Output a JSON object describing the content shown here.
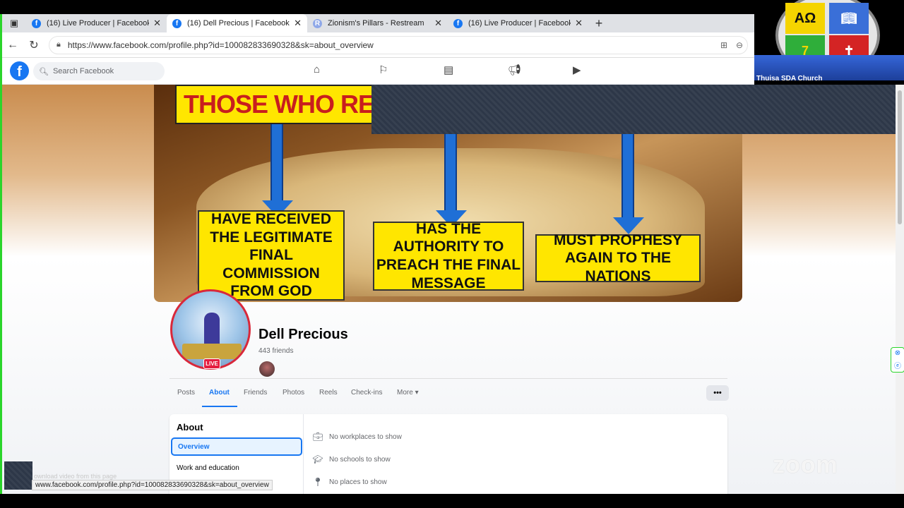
{
  "browser": {
    "tabs": [
      {
        "title": "(16) Live Producer | Facebook",
        "icon": "facebook-icon",
        "active": false
      },
      {
        "title": "(16) Dell Precious | Facebook",
        "icon": "facebook-icon",
        "active": true
      },
      {
        "title": "Zionism's Pillars - Restream",
        "icon": "restream-icon",
        "active": false
      },
      {
        "title": "(16) Live Producer | Facebook",
        "icon": "facebook-icon",
        "active": false
      }
    ],
    "url": "https://www.facebook.com/profile.php?id=100082833690328&sk=about_overview",
    "status_url": "www.facebook.com/profile.php?id=100082833690328&sk=about_overview",
    "faint_text": "ownload video from this page"
  },
  "facebook": {
    "search_placeholder": "Search Facebook",
    "cover": {
      "top_sign": "THOSE WHO REDI",
      "signs": [
        "HAVE RECEIVED THE LEGITIMATE FINAL COMMISSION FROM GOD",
        "HAS THE AUTHORITY TO PREACH THE FINAL MESSAGE",
        "MUST PROPHESY AGAIN TO THE NATIONS"
      ]
    },
    "profile": {
      "name": "Dell Precious",
      "friends": "443 friends",
      "live_badge": "LIVE"
    },
    "tabs": [
      "Posts",
      "About",
      "Friends",
      "Photos",
      "Reels",
      "Check-ins",
      "More"
    ],
    "active_tab": "About",
    "more_button": "•••",
    "about": {
      "title": "About",
      "menu": [
        "Overview",
        "Work and education"
      ],
      "rows": [
        {
          "icon": "briefcase-icon",
          "text": "No workplaces to show"
        },
        {
          "icon": "graduation-cap-icon",
          "text": "No schools to show"
        },
        {
          "icon": "location-pin-icon",
          "text": "No places to show"
        }
      ]
    }
  },
  "overlay": {
    "church_caption": "Thuisa SDA Church",
    "logo_symbols": [
      "ΑΩ",
      "7",
      "✝"
    ],
    "watermark": "zoom"
  },
  "colors": {
    "facebook_blue": "#1877f2",
    "live_red": "#e41e3f",
    "sign_yellow": "#ffe600",
    "zoom_border": "#2bd52b"
  }
}
